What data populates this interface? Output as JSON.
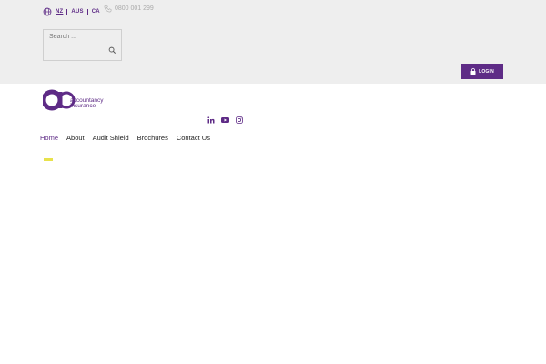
{
  "regions": [
    "NZ",
    "AUS",
    "CA"
  ],
  "active_region": "NZ",
  "phone": "0800 001 299",
  "search": {
    "placeholder": "Search ..."
  },
  "login_label": "LOGIN",
  "logo": {
    "line1": "accountancy",
    "line2": "insurance"
  },
  "social": [
    "linkedin-icon",
    "youtube-icon",
    "instagram-icon"
  ],
  "nav": [
    "Home",
    "About",
    "Audit Shield",
    "Brochures",
    "Contact Us"
  ],
  "colors": {
    "brand": "#5e2b86",
    "accent": "#e8e24c",
    "topbar": "#eeeeee"
  }
}
